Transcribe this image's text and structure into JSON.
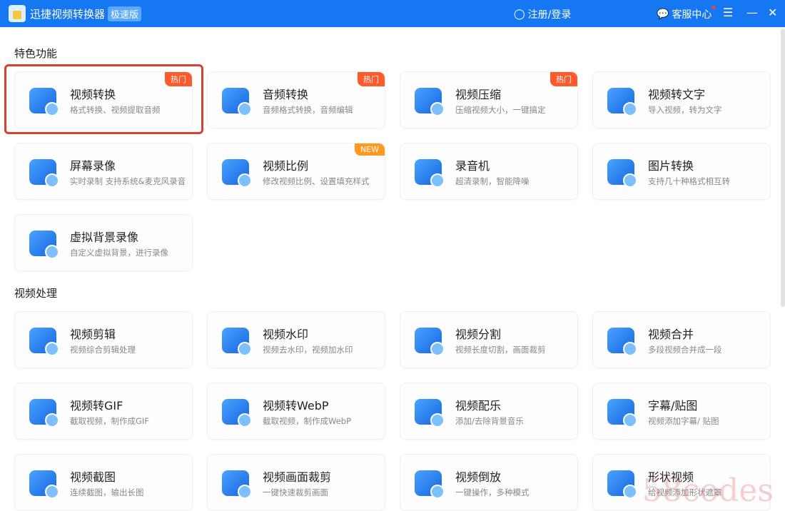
{
  "titlebar": {
    "app_title": "迅捷视频转换器",
    "edition": "极速版",
    "login": "注册/登录",
    "service": "客服中心",
    "menu_icon": "☰",
    "minimize": "—",
    "close": "✕"
  },
  "sections": [
    {
      "title": "特色功能",
      "cards": [
        {
          "title": "视频转换",
          "desc": "格式转换、视频提取音频",
          "tag": "热门"
        },
        {
          "title": "音频转换",
          "desc": "音频格式转换，音频编辑",
          "tag": "热门"
        },
        {
          "title": "视频压缩",
          "desc": "压缩视频大小，一键搞定",
          "tag": "热门"
        },
        {
          "title": "视频转文字",
          "desc": "导入视频，转为文字"
        },
        {
          "title": "屏幕录像",
          "desc": "实时录制 支持系统&麦克风录音"
        },
        {
          "title": "视频比例",
          "desc": "修改视频比例、设置填充样式",
          "tag": "NEW"
        },
        {
          "title": "录音机",
          "desc": "超清录制，智能降噪"
        },
        {
          "title": "图片转换",
          "desc": "支持几十种格式相互转"
        },
        {
          "title": "虚拟背景录像",
          "desc": "自定义虚拟背景，进行录像"
        }
      ]
    },
    {
      "title": "视频处理",
      "cards": [
        {
          "title": "视频剪辑",
          "desc": "视频综合剪辑处理"
        },
        {
          "title": "视频水印",
          "desc": "视频去水印，视频加水印"
        },
        {
          "title": "视频分割",
          "desc": "视频长度切割，画面裁剪"
        },
        {
          "title": "视频合并",
          "desc": "多段视频合并成一段"
        },
        {
          "title": "视频转GIF",
          "desc": "截取视频，制作成GIF"
        },
        {
          "title": "视频转WebP",
          "desc": "截取视频，制作成WebP"
        },
        {
          "title": "视频配乐",
          "desc": "添加/去除背景音乐"
        },
        {
          "title": "字幕/贴图",
          "desc": "视频添加字幕/ 贴图"
        },
        {
          "title": "视频截图",
          "desc": "连续截图，输出长图"
        },
        {
          "title": "视频画面裁剪",
          "desc": "一键快速裁剪画面"
        },
        {
          "title": "视频倒放",
          "desc": "一键操作，多种模式"
        },
        {
          "title": "形状视频",
          "desc": "给视频添加形状遮罩"
        }
      ]
    }
  ],
  "watermark": "58codes",
  "colors": {
    "titlebar": "#1677f2",
    "hot_tag": "#ff5a2c",
    "new_tag": "#ff9a1f",
    "highlight": "#d9402f"
  }
}
